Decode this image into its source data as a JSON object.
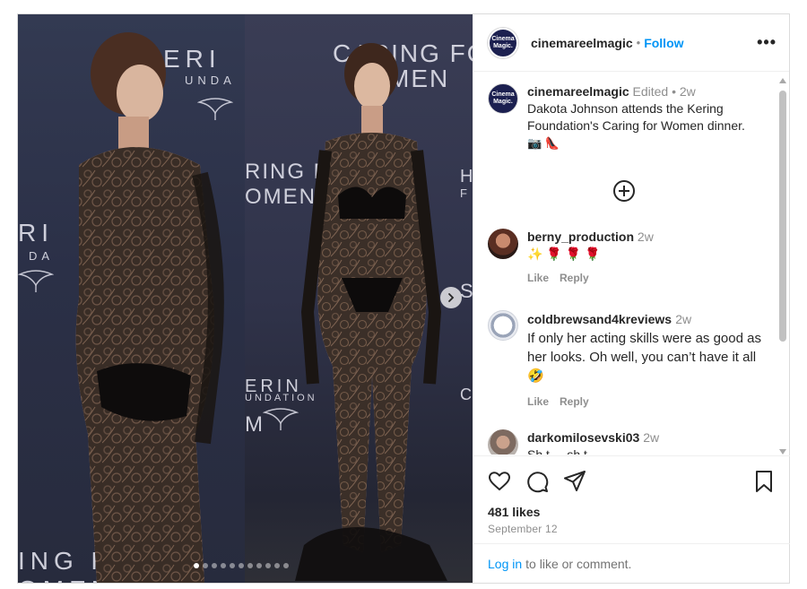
{
  "post": {
    "media": {
      "backdrop_left": {
        "top_word": "ERI",
        "sub_word": "UNDA",
        "mid_word": "RI",
        "mid_sub": "DA",
        "bottom_word": "ING FO",
        "bottom_word2": "OMEN"
      },
      "backdrop_right": {
        "top_line1": "CARING FOR",
        "top_line2": "MEN",
        "mid_line1": "RING FO",
        "mid_line2": "OMEN",
        "lower_line1": "ERIN",
        "lower_line2": "UNDATION",
        "lower_line3": "M",
        "edge_h": "H",
        "edge_f": "F",
        "edge_s": "S",
        "edge_c": "C"
      },
      "carousel_dots": 11,
      "active_dot": 0,
      "next_icon": "chevron-right-icon"
    },
    "header": {
      "avatar_text": "Cinema Magic.",
      "username": "cinemareelmagic",
      "separator": "•",
      "follow_label": "Follow",
      "more_icon": "ellipsis-icon",
      "more_label": "•••"
    },
    "caption": {
      "username": "cinemareelmagic",
      "meta": "Edited • 2w",
      "text": "Dakota Johnson attends the Kering Foundation's Caring for Women dinner.",
      "emojis": "📷 👠"
    },
    "load_more_icon": "plus-circle-icon",
    "comments": [
      {
        "username": "berny_production",
        "time": "2w",
        "text": "✨ 🌹 🌹 🌹",
        "like_label": "Like",
        "reply_label": "Reply"
      },
      {
        "username": "coldbrewsand4kreviews",
        "time": "2w",
        "text": "If only her acting skills were as good as her looks. Oh well, you can’t have it all 🤣",
        "like_label": "Like",
        "reply_label": "Reply"
      },
      {
        "username": "darkomilosevski03",
        "time": "2w",
        "text": "Sh t ... sh t"
      }
    ],
    "actions": {
      "icons": [
        "heart-icon",
        "comment-icon",
        "share-icon",
        "bookmark-icon"
      ],
      "likes": "481 likes",
      "date": "September 12"
    },
    "login": {
      "link_label": "Log in",
      "rest_label": "to like or comment."
    }
  }
}
